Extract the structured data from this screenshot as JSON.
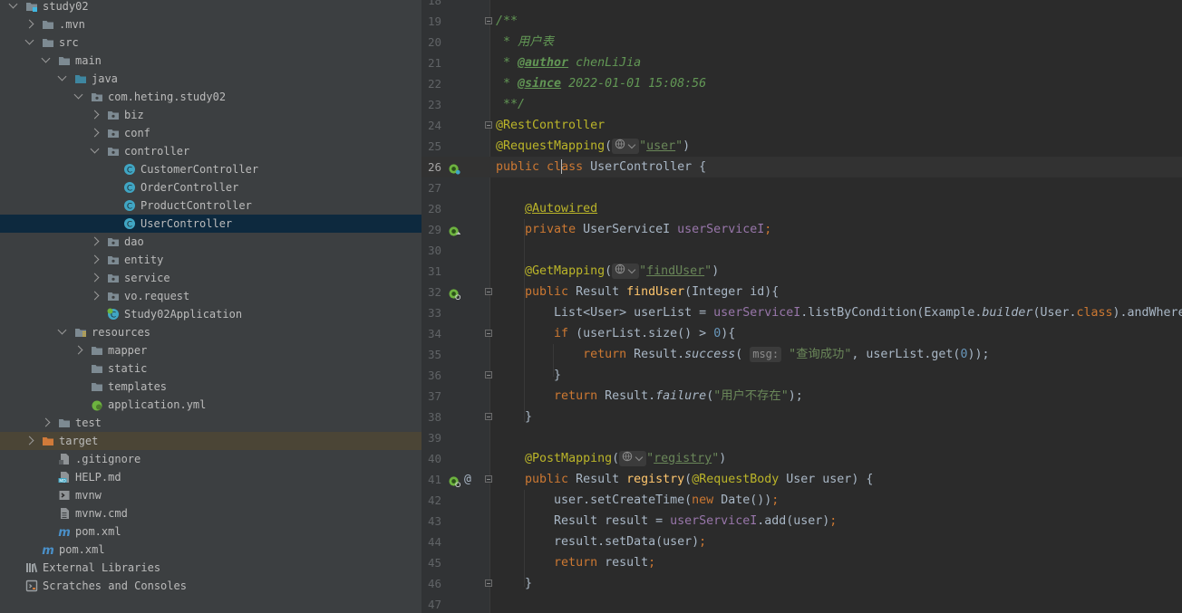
{
  "project_tree": {
    "items": [
      {
        "label": "study02",
        "depth": 0,
        "expanded": true,
        "icon": "module-folder-icon"
      },
      {
        "label": ".mvn",
        "depth": 1,
        "expanded": false,
        "icon": "folder-icon"
      },
      {
        "label": "src",
        "depth": 1,
        "expanded": true,
        "icon": "folder-icon"
      },
      {
        "label": "main",
        "depth": 2,
        "expanded": true,
        "icon": "folder-icon"
      },
      {
        "label": "java",
        "depth": 3,
        "expanded": true,
        "icon": "source-folder-icon"
      },
      {
        "label": "com.heting.study02",
        "depth": 4,
        "expanded": true,
        "icon": "package-icon"
      },
      {
        "label": "biz",
        "depth": 5,
        "expanded": false,
        "icon": "package-icon"
      },
      {
        "label": "conf",
        "depth": 5,
        "expanded": false,
        "icon": "package-icon"
      },
      {
        "label": "controller",
        "depth": 5,
        "expanded": true,
        "icon": "package-icon"
      },
      {
        "label": "CustomerController",
        "depth": 6,
        "icon": "java-class-icon"
      },
      {
        "label": "OrderController",
        "depth": 6,
        "icon": "java-class-icon"
      },
      {
        "label": "ProductController",
        "depth": 6,
        "icon": "java-class-icon"
      },
      {
        "label": "UserController",
        "depth": 6,
        "icon": "java-class-icon",
        "selected": true
      },
      {
        "label": "dao",
        "depth": 5,
        "expanded": false,
        "icon": "package-icon"
      },
      {
        "label": "entity",
        "depth": 5,
        "expanded": false,
        "icon": "package-icon"
      },
      {
        "label": "service",
        "depth": 5,
        "expanded": false,
        "icon": "package-icon"
      },
      {
        "label": "vo.request",
        "depth": 5,
        "expanded": false,
        "icon": "package-icon"
      },
      {
        "label": "Study02Application",
        "depth": 5,
        "icon": "spring-boot-class-icon"
      },
      {
        "label": "resources",
        "depth": 3,
        "expanded": true,
        "icon": "resources-folder-icon"
      },
      {
        "label": "mapper",
        "depth": 4,
        "expanded": false,
        "icon": "folder-icon"
      },
      {
        "label": "static",
        "depth": 4,
        "icon": "folder-icon"
      },
      {
        "label": "templates",
        "depth": 4,
        "icon": "folder-icon"
      },
      {
        "label": "application.yml",
        "depth": 4,
        "icon": "spring-yml-icon"
      },
      {
        "label": "test",
        "depth": 2,
        "expanded": false,
        "icon": "folder-icon"
      },
      {
        "label": "target",
        "depth": 1,
        "expanded": false,
        "icon": "excluded-folder-icon",
        "excluded": true
      },
      {
        "label": ".gitignore",
        "depth": 2,
        "icon": "gitignore-file-icon"
      },
      {
        "label": "HELP.md",
        "depth": 2,
        "icon": "markdown-file-icon"
      },
      {
        "label": "mvnw",
        "depth": 2,
        "icon": "shell-file-icon"
      },
      {
        "label": "mvnw.cmd",
        "depth": 2,
        "icon": "text-file-icon"
      },
      {
        "label": "pom.xml",
        "depth": 2,
        "icon": "maven-file-icon"
      },
      {
        "label": "pom.xml",
        "depth": 1,
        "icon": "maven-file-icon"
      },
      {
        "label": "External Libraries",
        "depth": 0,
        "icon": "libraries-icon"
      },
      {
        "label": "Scratches and Consoles",
        "depth": 0,
        "icon": "scratches-icon"
      }
    ]
  },
  "editor": {
    "current_line": "26",
    "lines": [
      {
        "n": "18",
        "tokens": []
      },
      {
        "n": "19",
        "fold": true,
        "tokens": [
          {
            "t": "/**",
            "c": "cm"
          }
        ]
      },
      {
        "n": "20",
        "tokens": [
          {
            "t": " * 用户表",
            "c": "cm"
          }
        ]
      },
      {
        "n": "21",
        "tokens": [
          {
            "t": " * ",
            "c": "cm"
          },
          {
            "t": "@author",
            "c": "doctag"
          },
          {
            "t": " chenLiJia",
            "c": "cm"
          }
        ]
      },
      {
        "n": "22",
        "tokens": [
          {
            "t": " * ",
            "c": "cm"
          },
          {
            "t": "@since",
            "c": "doctag"
          },
          {
            "t": " 2022-01-01 15:08:56",
            "c": "cm"
          }
        ]
      },
      {
        "n": "23",
        "tokens": [
          {
            "t": " **/",
            "c": "cm"
          }
        ]
      },
      {
        "n": "24",
        "fold": true,
        "tokens": [
          {
            "t": "@RestController",
            "c": "ann"
          }
        ]
      },
      {
        "n": "25",
        "tokens": [
          {
            "t": "@RequestMapping",
            "c": "ann"
          },
          {
            "t": "(",
            "c": ""
          },
          {
            "hint": "globe-icon"
          },
          {
            "t": "\"",
            "c": "str"
          },
          {
            "t": "user",
            "c": "str ul"
          },
          {
            "t": "\"",
            "c": "str"
          },
          {
            "t": ")",
            "c": ""
          }
        ]
      },
      {
        "n": "26",
        "gutter": "bean-icon",
        "tokens": [
          {
            "t": "public ",
            "c": "kw"
          },
          {
            "t": "cl",
            "c": "kw"
          },
          {
            "caret": true
          },
          {
            "t": "ass ",
            "c": "kw"
          },
          {
            "t": "UserController {",
            "c": ""
          }
        ]
      },
      {
        "n": "27",
        "tokens": []
      },
      {
        "n": "28",
        "tokens": [
          {
            "t": "    "
          },
          {
            "t": "@Autowired",
            "c": "ann ul"
          }
        ]
      },
      {
        "n": "29",
        "gutter": "autowired-icon",
        "tokens": [
          {
            "t": "    "
          },
          {
            "t": "private ",
            "c": "kw"
          },
          {
            "t": "UserServiceI ",
            "c": ""
          },
          {
            "t": "userServiceI",
            "c": "fld"
          },
          {
            "t": ";",
            "c": "kw"
          }
        ]
      },
      {
        "n": "30",
        "tokens": []
      },
      {
        "n": "31",
        "tokens": [
          {
            "t": "    "
          },
          {
            "t": "@GetMapping",
            "c": "ann"
          },
          {
            "t": "(",
            "c": ""
          },
          {
            "hint": "globe-icon"
          },
          {
            "t": "\"",
            "c": "str"
          },
          {
            "t": "findUser",
            "c": "str ul"
          },
          {
            "t": "\"",
            "c": "str"
          },
          {
            "t": ")",
            "c": ""
          }
        ]
      },
      {
        "n": "32",
        "gutter": "endpoint-icon",
        "fold": true,
        "tokens": [
          {
            "t": "    "
          },
          {
            "t": "public ",
            "c": "kw"
          },
          {
            "t": "Result ",
            "c": ""
          },
          {
            "t": "findUser",
            "c": "fn"
          },
          {
            "t": "(Integer id){",
            "c": ""
          }
        ]
      },
      {
        "n": "33",
        "tokens": [
          {
            "t": "        "
          },
          {
            "t": "List<User> userList = ",
            "c": ""
          },
          {
            "t": "userServiceI",
            "c": "fld"
          },
          {
            "t": ".listByCondition(Example.",
            "c": ""
          },
          {
            "t": "builder",
            "c": "it"
          },
          {
            "t": "(User.",
            "c": ""
          },
          {
            "t": "class",
            "c": "kw"
          },
          {
            "t": ").andWhere",
            "c": ""
          }
        ]
      },
      {
        "n": "34",
        "fold": true,
        "tokens": [
          {
            "t": "        "
          },
          {
            "t": "if ",
            "c": "kw"
          },
          {
            "t": "(userList.size() > ",
            "c": ""
          },
          {
            "t": "0",
            "c": "num"
          },
          {
            "t": "){",
            "c": ""
          }
        ]
      },
      {
        "n": "35",
        "tokens": [
          {
            "t": "            "
          },
          {
            "t": "return ",
            "c": "kw"
          },
          {
            "t": "Result.",
            "c": ""
          },
          {
            "t": "success",
            "c": "it"
          },
          {
            "t": "( ",
            "c": ""
          },
          {
            "hint_text": "msg:"
          },
          {
            "t": " ",
            "c": ""
          },
          {
            "t": "\"查询成功\"",
            "c": "str"
          },
          {
            "t": ", userList.get(",
            "c": ""
          },
          {
            "t": "0",
            "c": "num"
          },
          {
            "t": "));",
            "c": ""
          }
        ]
      },
      {
        "n": "36",
        "fold": true,
        "tokens": [
          {
            "t": "        "
          },
          {
            "t": "}",
            "c": ""
          }
        ]
      },
      {
        "n": "37",
        "tokens": [
          {
            "t": "        "
          },
          {
            "t": "return ",
            "c": "kw"
          },
          {
            "t": "Result.",
            "c": ""
          },
          {
            "t": "failure",
            "c": "it"
          },
          {
            "t": "(",
            "c": ""
          },
          {
            "t": "\"用户不存在\"",
            "c": "str"
          },
          {
            "t": ");",
            "c": ""
          }
        ]
      },
      {
        "n": "38",
        "fold": true,
        "tokens": [
          {
            "t": "    "
          },
          {
            "t": "}",
            "c": ""
          }
        ]
      },
      {
        "n": "39",
        "tokens": []
      },
      {
        "n": "40",
        "tokens": [
          {
            "t": "    "
          },
          {
            "t": "@PostMapping",
            "c": "ann"
          },
          {
            "t": "(",
            "c": ""
          },
          {
            "hint": "globe-icon"
          },
          {
            "t": "\"",
            "c": "str"
          },
          {
            "t": "registry",
            "c": "str ul"
          },
          {
            "t": "\"",
            "c": "str"
          },
          {
            "t": ")",
            "c": ""
          }
        ]
      },
      {
        "n": "41",
        "gutter": "endpoint-icon",
        "gutter2": "@",
        "fold": true,
        "tokens": [
          {
            "t": "    "
          },
          {
            "t": "public ",
            "c": "kw"
          },
          {
            "t": "Result ",
            "c": ""
          },
          {
            "t": "registry",
            "c": "fn"
          },
          {
            "t": "(",
            "c": ""
          },
          {
            "t": "@RequestBody ",
            "c": "ann"
          },
          {
            "t": "User user) {",
            "c": ""
          }
        ]
      },
      {
        "n": "42",
        "tokens": [
          {
            "t": "        "
          },
          {
            "t": "user.setCreateTime(",
            "c": ""
          },
          {
            "t": "new ",
            "c": "kw"
          },
          {
            "t": "Date())",
            "c": ""
          },
          {
            "t": ";",
            "c": "kw"
          }
        ]
      },
      {
        "n": "43",
        "tokens": [
          {
            "t": "        "
          },
          {
            "t": "Result result = ",
            "c": ""
          },
          {
            "t": "userServiceI",
            "c": "fld"
          },
          {
            "t": ".add(user)",
            "c": ""
          },
          {
            "t": ";",
            "c": "kw"
          }
        ]
      },
      {
        "n": "44",
        "tokens": [
          {
            "t": "        "
          },
          {
            "t": "result.setData(user)",
            "c": ""
          },
          {
            "t": ";",
            "c": "kw"
          }
        ]
      },
      {
        "n": "45",
        "tokens": [
          {
            "t": "        "
          },
          {
            "t": "return ",
            "c": "kw"
          },
          {
            "t": "result",
            "c": ""
          },
          {
            "t": ";",
            "c": "kw"
          }
        ]
      },
      {
        "n": "46",
        "fold": true,
        "tokens": [
          {
            "t": "    "
          },
          {
            "t": "}",
            "c": ""
          }
        ]
      },
      {
        "n": "47",
        "tokens": []
      }
    ]
  },
  "colors": {
    "tree_bg": "#3c3f41",
    "editor_bg": "#2b2b2b",
    "gutter_bg": "#313335",
    "selection": "#0d293e",
    "excluded_row": "#4b4536",
    "keyword": "#cc7832",
    "annotation": "#bbb529",
    "string": "#6a8759",
    "field": "#9876aa"
  }
}
